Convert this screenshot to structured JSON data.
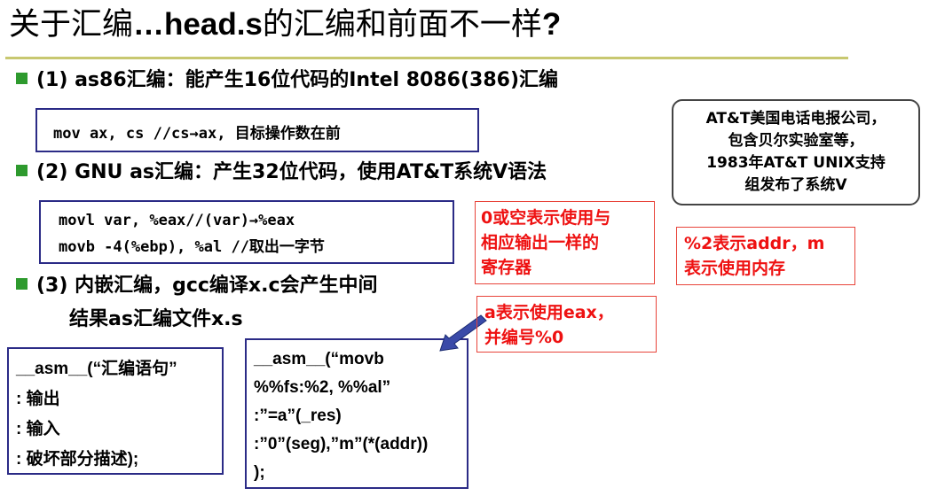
{
  "title": {
    "part1": "关于汇编",
    "part2": "…head.s",
    "part3": "的汇编和前面不一样",
    "part4": "?"
  },
  "bullets": [
    {
      "label": "(1) as86汇编：能产生16位代码的Intel 8086(386)汇编"
    },
    {
      "label": "(2) GNU as汇编：产生32位代码，使用AT&T系统V语法"
    },
    {
      "line1": "(3) 内嵌汇编，gcc编译x.c会产生中间",
      "line2": "结果as汇编文件x.s"
    }
  ],
  "code1": "mov ax, cs //cs→ax, 目标操作数在前",
  "code2": [
    "movl var, %eax//(var)→%eax",
    "movb -4(%ebp), %al //取出一字节"
  ],
  "asm_template": [
    "__asm__(“汇编语句”",
    ": 输出",
    ": 输入",
    ": 破坏部分描述);"
  ],
  "asm_example": [
    "__asm__(“movb",
    "%%fs:%2, %%al”",
    ":”=a”(_res)",
    ":”0”(seg),”m”(*(addr))",
    ");"
  ],
  "notes": {
    "zero": [
      "0或空表示使用与",
      "相应输出一样的",
      "寄存器"
    ],
    "a_eax": [
      "a表示使用eax，",
      "并编号%0"
    ],
    "addr": [
      "%2表示addr，m",
      "表示使用内存"
    ],
    "att": [
      "AT&T美国电话电报公司，",
      "包含贝尔实验室等，",
      "1983年AT&T UNIX支持",
      "组发布了系统V"
    ]
  },
  "colors": {
    "bullet": "#2e9a2e",
    "code_border": "#2b2b86",
    "note_red": "#e11111",
    "rule": "#c8c870",
    "arrow": "#3a4aa8"
  }
}
